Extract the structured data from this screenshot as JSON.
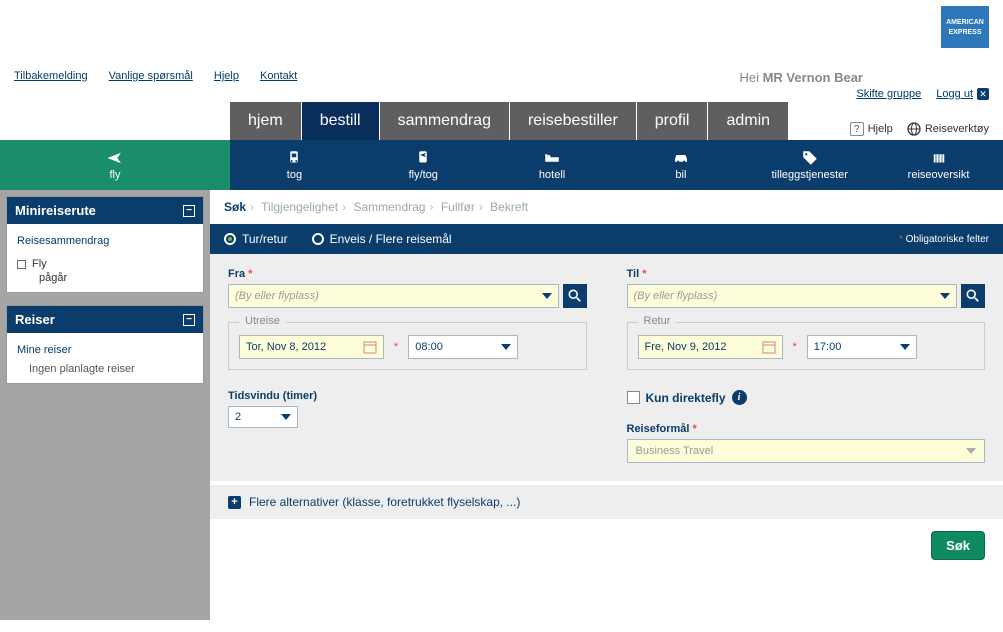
{
  "top_links": {
    "feedback": "Tilbakemelding",
    "faq": "Vanlige spørsmål",
    "help": "Hjelp",
    "contact": "Kontakt"
  },
  "greeting": {
    "prefix": "Hei ",
    "name": "MR Vernon Bear"
  },
  "user_actions": {
    "switch_group": "Skifte gruppe",
    "logout": "Logg ut"
  },
  "main_tabs": {
    "home": "hjem",
    "book": "bestill",
    "summary": "sammendrag",
    "arranger": "reisebestiller",
    "profile": "profil",
    "admin": "admin"
  },
  "tool_right": {
    "help": "Hjelp",
    "tools": "Reiseverktøy"
  },
  "nav": {
    "fly": "fly",
    "tog": "tog",
    "flytog": "fly/tog",
    "hotell": "hotell",
    "bil": "bil",
    "extra": "tilleggstjenester",
    "overview": "reiseoversikt"
  },
  "sidebar": {
    "mini_title": "Minireiserute",
    "summary_link": "Reisesammendrag",
    "fly_label": "Fly",
    "status": "pågår",
    "reiser_title": "Reiser",
    "mine_reiser": "Mine reiser",
    "no_trips": "Ingen planlagte reiser"
  },
  "breadcrumb": {
    "s1": "Søk",
    "s2": "Tilgjengelighet",
    "s3": "Sammendrag",
    "s4": "Fullfør",
    "s5": "Bekreft"
  },
  "trip_type": {
    "return": "Tur/retur",
    "oneway": "Enveis / Flere reisemål"
  },
  "mandatory": "Obligatoriske felter",
  "form": {
    "from_label": "Fra",
    "to_label": "Til",
    "place_placeholder": "(By eller flyplass)",
    "out_legend": "Utreise",
    "ret_legend": "Retur",
    "out_date": "Tor, Nov 8, 2012",
    "out_time": "08:00",
    "ret_date": "Fre, Nov 9, 2012",
    "ret_time": "17:00",
    "timewindow_label": "Tidsvindu (timer)",
    "timewindow_value": "2",
    "direct_label": "Kun direktefly",
    "purpose_label": "Reiseformål",
    "purpose_value": "Business Travel",
    "more_options": "Flere alternativer (klasse, foretrukket flyselskap, ...)"
  },
  "submit": "Søk"
}
